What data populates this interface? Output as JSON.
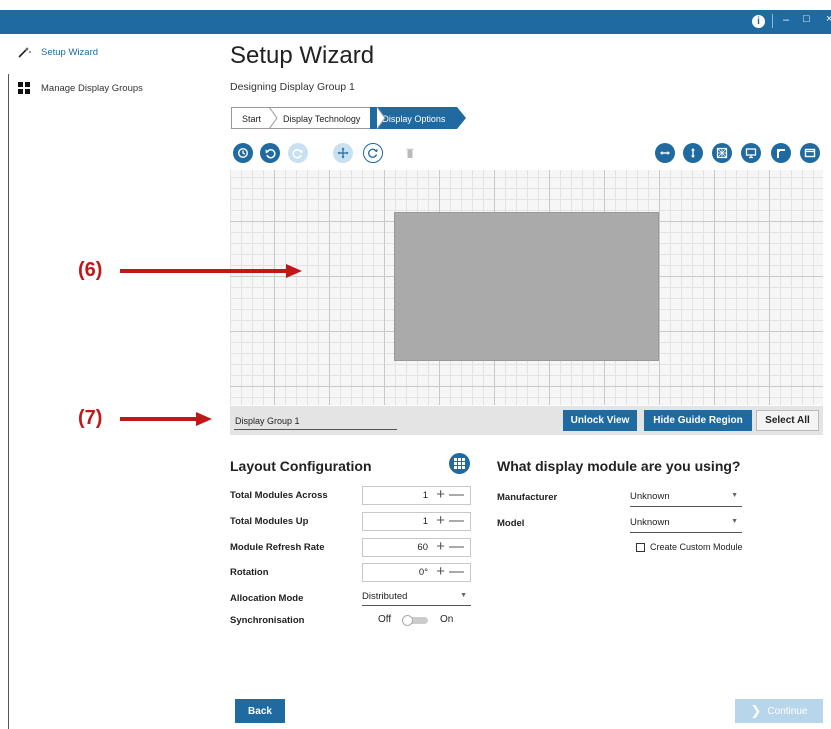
{
  "titlebar": {
    "info_icon": "info-icon",
    "min_glyph": "–",
    "max_glyph": "□",
    "close_glyph": "×"
  },
  "sidebar": {
    "items": [
      {
        "label": "Setup Wizard",
        "icon": "magic-wand-icon",
        "active": true
      },
      {
        "label": "Manage Display Groups",
        "icon": "grid-icon",
        "active": false
      }
    ]
  },
  "header": {
    "title": "Setup Wizard",
    "subtitle": "Designing Display Group 1"
  },
  "breadcrumb": [
    "Start",
    "Display Technology",
    "Display Options"
  ],
  "toolbar": {
    "left": [
      "history-icon",
      "undo-icon",
      "redo-icon",
      "move-icon",
      "rotate-icon",
      "delete-icon"
    ],
    "right": [
      "fit-width-icon",
      "fit-height-icon",
      "pattern-icon",
      "monitor-icon",
      "corner-icon",
      "frame-icon"
    ]
  },
  "canvas": {
    "group_name": "Display Group 1",
    "unlock_label": "Unlock View",
    "hide_guide_label": "Hide Guide Region",
    "select_all_label": "Select All"
  },
  "layout_config": {
    "title": "Layout Configuration",
    "rows": [
      {
        "label": "Total Modules Across",
        "value": "1"
      },
      {
        "label": "Total Modules Up",
        "value": "1"
      },
      {
        "label": "Module Refresh Rate",
        "value": "60"
      },
      {
        "label": "Rotation",
        "value": "0°"
      }
    ],
    "allocation_label": "Allocation Mode",
    "allocation_value": "Distributed",
    "sync_label": "Synchronisation",
    "sync_off": "Off",
    "sync_on": "On",
    "sync_state": "off",
    "plus": "+",
    "minus": "—"
  },
  "module": {
    "title": "What display module are you using?",
    "manufacturer_label": "Manufacturer",
    "manufacturer_value": "Unknown",
    "model_label": "Model",
    "model_value": "Unknown",
    "custom_label": "Create Custom Module"
  },
  "footer": {
    "back_label": "Back",
    "continue_label": "Continue"
  },
  "annotations": [
    {
      "label": "(6)"
    },
    {
      "label": "(7)"
    }
  ],
  "colors": {
    "accent": "#1f6aa0",
    "accent_disabled": "#b7d6ea",
    "callout": "#c01818",
    "display_region": "#aaaaaa"
  }
}
